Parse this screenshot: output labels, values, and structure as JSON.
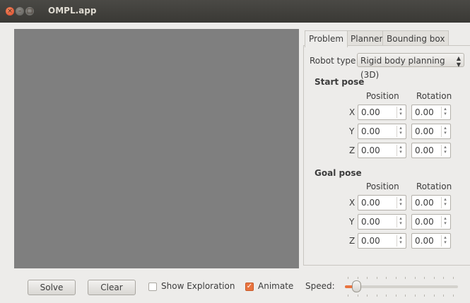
{
  "window": {
    "title": "OMPL.app"
  },
  "tabs": [
    {
      "label": "Problem",
      "active": true
    },
    {
      "label": "Planner",
      "active": false
    },
    {
      "label": "Bounding box",
      "active": false
    }
  ],
  "problem": {
    "robot_type_label": "Robot type",
    "robot_type_value": "Rigid body planning (3D)",
    "start_pose": {
      "heading": "Start pose",
      "position_header": "Position",
      "rotation_header": "Rotation",
      "rows": [
        {
          "axis": "X",
          "position": "0.00",
          "rotation": "0.00"
        },
        {
          "axis": "Y",
          "position": "0.00",
          "rotation": "0.00"
        },
        {
          "axis": "Z",
          "position": "0.00",
          "rotation": "0.00"
        }
      ]
    },
    "goal_pose": {
      "heading": "Goal pose",
      "position_header": "Position",
      "rotation_header": "Rotation",
      "rows": [
        {
          "axis": "X",
          "position": "0.00",
          "rotation": "0.00"
        },
        {
          "axis": "Y",
          "position": "0.00",
          "rotation": "0.00"
        },
        {
          "axis": "Z",
          "position": "0.00",
          "rotation": "0.00"
        }
      ]
    }
  },
  "bottom": {
    "solve_label": "Solve",
    "clear_label": "Clear",
    "show_exploration_label": "Show Exploration",
    "show_exploration_checked": false,
    "animate_label": "Animate",
    "animate_checked": true,
    "speed_label": "Speed:",
    "speed_fraction": 0.1
  },
  "colors": {
    "accent": "#e9743f",
    "viewport": "#7f7f7f",
    "titlebar": "#3c3b37"
  }
}
